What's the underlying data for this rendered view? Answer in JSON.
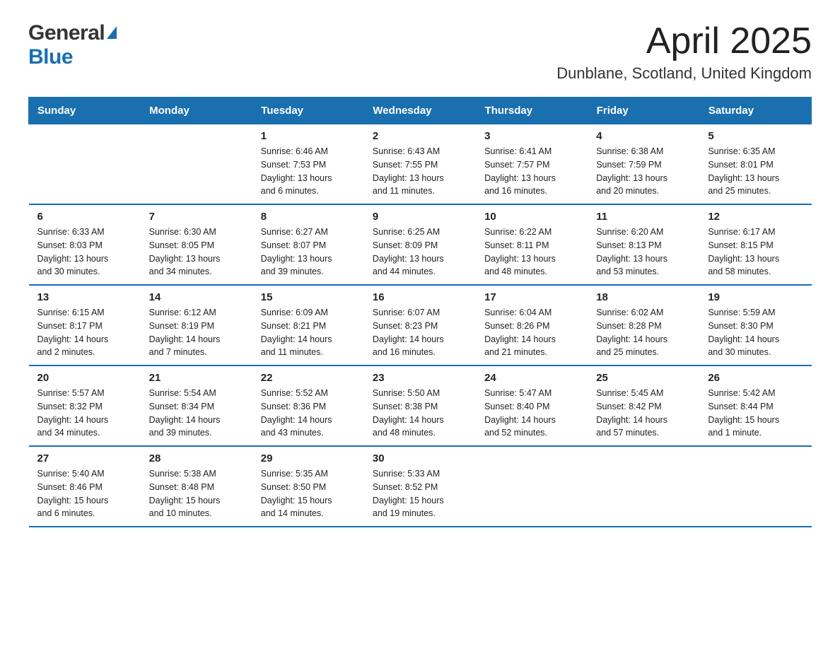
{
  "header": {
    "title": "April 2025",
    "subtitle": "Dunblane, Scotland, United Kingdom",
    "logo_general": "General",
    "logo_blue": "Blue"
  },
  "calendar": {
    "days_of_week": [
      "Sunday",
      "Monday",
      "Tuesday",
      "Wednesday",
      "Thursday",
      "Friday",
      "Saturday"
    ],
    "weeks": [
      [
        {
          "day": "",
          "info": ""
        },
        {
          "day": "",
          "info": ""
        },
        {
          "day": "1",
          "info": "Sunrise: 6:46 AM\nSunset: 7:53 PM\nDaylight: 13 hours\nand 6 minutes."
        },
        {
          "day": "2",
          "info": "Sunrise: 6:43 AM\nSunset: 7:55 PM\nDaylight: 13 hours\nand 11 minutes."
        },
        {
          "day": "3",
          "info": "Sunrise: 6:41 AM\nSunset: 7:57 PM\nDaylight: 13 hours\nand 16 minutes."
        },
        {
          "day": "4",
          "info": "Sunrise: 6:38 AM\nSunset: 7:59 PM\nDaylight: 13 hours\nand 20 minutes."
        },
        {
          "day": "5",
          "info": "Sunrise: 6:35 AM\nSunset: 8:01 PM\nDaylight: 13 hours\nand 25 minutes."
        }
      ],
      [
        {
          "day": "6",
          "info": "Sunrise: 6:33 AM\nSunset: 8:03 PM\nDaylight: 13 hours\nand 30 minutes."
        },
        {
          "day": "7",
          "info": "Sunrise: 6:30 AM\nSunset: 8:05 PM\nDaylight: 13 hours\nand 34 minutes."
        },
        {
          "day": "8",
          "info": "Sunrise: 6:27 AM\nSunset: 8:07 PM\nDaylight: 13 hours\nand 39 minutes."
        },
        {
          "day": "9",
          "info": "Sunrise: 6:25 AM\nSunset: 8:09 PM\nDaylight: 13 hours\nand 44 minutes."
        },
        {
          "day": "10",
          "info": "Sunrise: 6:22 AM\nSunset: 8:11 PM\nDaylight: 13 hours\nand 48 minutes."
        },
        {
          "day": "11",
          "info": "Sunrise: 6:20 AM\nSunset: 8:13 PM\nDaylight: 13 hours\nand 53 minutes."
        },
        {
          "day": "12",
          "info": "Sunrise: 6:17 AM\nSunset: 8:15 PM\nDaylight: 13 hours\nand 58 minutes."
        }
      ],
      [
        {
          "day": "13",
          "info": "Sunrise: 6:15 AM\nSunset: 8:17 PM\nDaylight: 14 hours\nand 2 minutes."
        },
        {
          "day": "14",
          "info": "Sunrise: 6:12 AM\nSunset: 8:19 PM\nDaylight: 14 hours\nand 7 minutes."
        },
        {
          "day": "15",
          "info": "Sunrise: 6:09 AM\nSunset: 8:21 PM\nDaylight: 14 hours\nand 11 minutes."
        },
        {
          "day": "16",
          "info": "Sunrise: 6:07 AM\nSunset: 8:23 PM\nDaylight: 14 hours\nand 16 minutes."
        },
        {
          "day": "17",
          "info": "Sunrise: 6:04 AM\nSunset: 8:26 PM\nDaylight: 14 hours\nand 21 minutes."
        },
        {
          "day": "18",
          "info": "Sunrise: 6:02 AM\nSunset: 8:28 PM\nDaylight: 14 hours\nand 25 minutes."
        },
        {
          "day": "19",
          "info": "Sunrise: 5:59 AM\nSunset: 8:30 PM\nDaylight: 14 hours\nand 30 minutes."
        }
      ],
      [
        {
          "day": "20",
          "info": "Sunrise: 5:57 AM\nSunset: 8:32 PM\nDaylight: 14 hours\nand 34 minutes."
        },
        {
          "day": "21",
          "info": "Sunrise: 5:54 AM\nSunset: 8:34 PM\nDaylight: 14 hours\nand 39 minutes."
        },
        {
          "day": "22",
          "info": "Sunrise: 5:52 AM\nSunset: 8:36 PM\nDaylight: 14 hours\nand 43 minutes."
        },
        {
          "day": "23",
          "info": "Sunrise: 5:50 AM\nSunset: 8:38 PM\nDaylight: 14 hours\nand 48 minutes."
        },
        {
          "day": "24",
          "info": "Sunrise: 5:47 AM\nSunset: 8:40 PM\nDaylight: 14 hours\nand 52 minutes."
        },
        {
          "day": "25",
          "info": "Sunrise: 5:45 AM\nSunset: 8:42 PM\nDaylight: 14 hours\nand 57 minutes."
        },
        {
          "day": "26",
          "info": "Sunrise: 5:42 AM\nSunset: 8:44 PM\nDaylight: 15 hours\nand 1 minute."
        }
      ],
      [
        {
          "day": "27",
          "info": "Sunrise: 5:40 AM\nSunset: 8:46 PM\nDaylight: 15 hours\nand 6 minutes."
        },
        {
          "day": "28",
          "info": "Sunrise: 5:38 AM\nSunset: 8:48 PM\nDaylight: 15 hours\nand 10 minutes."
        },
        {
          "day": "29",
          "info": "Sunrise: 5:35 AM\nSunset: 8:50 PM\nDaylight: 15 hours\nand 14 minutes."
        },
        {
          "day": "30",
          "info": "Sunrise: 5:33 AM\nSunset: 8:52 PM\nDaylight: 15 hours\nand 19 minutes."
        },
        {
          "day": "",
          "info": ""
        },
        {
          "day": "",
          "info": ""
        },
        {
          "day": "",
          "info": ""
        }
      ]
    ]
  }
}
